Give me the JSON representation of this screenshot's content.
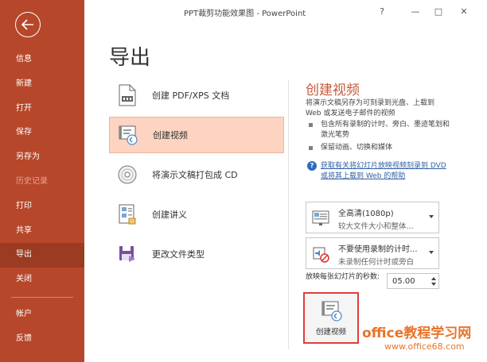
{
  "window": {
    "title": "PPT裁剪功能效果图  -  PowerPoint",
    "help": "?",
    "minimize": "—",
    "restore": "□",
    "close": "✕"
  },
  "sidebar": {
    "items": [
      {
        "label": "信息"
      },
      {
        "label": "新建"
      },
      {
        "label": "打开"
      },
      {
        "label": "保存"
      },
      {
        "label": "另存为"
      },
      {
        "label": "历史记录"
      },
      {
        "label": "打印"
      },
      {
        "label": "共享"
      },
      {
        "label": "导出"
      },
      {
        "label": "关闭"
      },
      {
        "label": "帐户"
      },
      {
        "label": "反馈"
      }
    ],
    "active_index": 8
  },
  "page": {
    "title": "导出"
  },
  "export_options": [
    {
      "label": "创建 PDF/XPS 文档",
      "icon": "pdf-document-icon"
    },
    {
      "label": "创建视频",
      "icon": "video-icon"
    },
    {
      "label": "将演示文稿打包成 CD",
      "icon": "cd-icon"
    },
    {
      "label": "创建讲义",
      "icon": "handout-icon"
    },
    {
      "label": "更改文件类型",
      "icon": "save-file-type-icon"
    }
  ],
  "panel": {
    "title": "创建视频",
    "description": "将演示文稿另存为可刻录到光盘、上载到 Web 或发送电子邮件的视频",
    "bullets": [
      "包含所有录制的计时、旁白、墨迹笔划和激光笔势",
      "保留动画、切换和媒体"
    ],
    "help_link": "获取有关将幻灯片放映视频刻录到 DVD 或将其上载到 Web 的帮助",
    "quality": {
      "main": "全高清(1080p)",
      "sub": "较大文件大小和整体..."
    },
    "timing": {
      "main": "不要使用录制的计时...",
      "sub": "未录制任何计时或旁白"
    },
    "seconds_label": "放映每张幻灯片的秒数:",
    "seconds_value": "05.00",
    "create_button": "创建视频"
  },
  "watermark": {
    "line1": "office教程学习网",
    "line2": "www.office68.com"
  },
  "colors": {
    "sidebar": "#b7472a",
    "accent": "#c55a3c",
    "selected": "#fcd4c1",
    "highlight_border": "#e23b3b",
    "watermark": "#e8742a"
  }
}
